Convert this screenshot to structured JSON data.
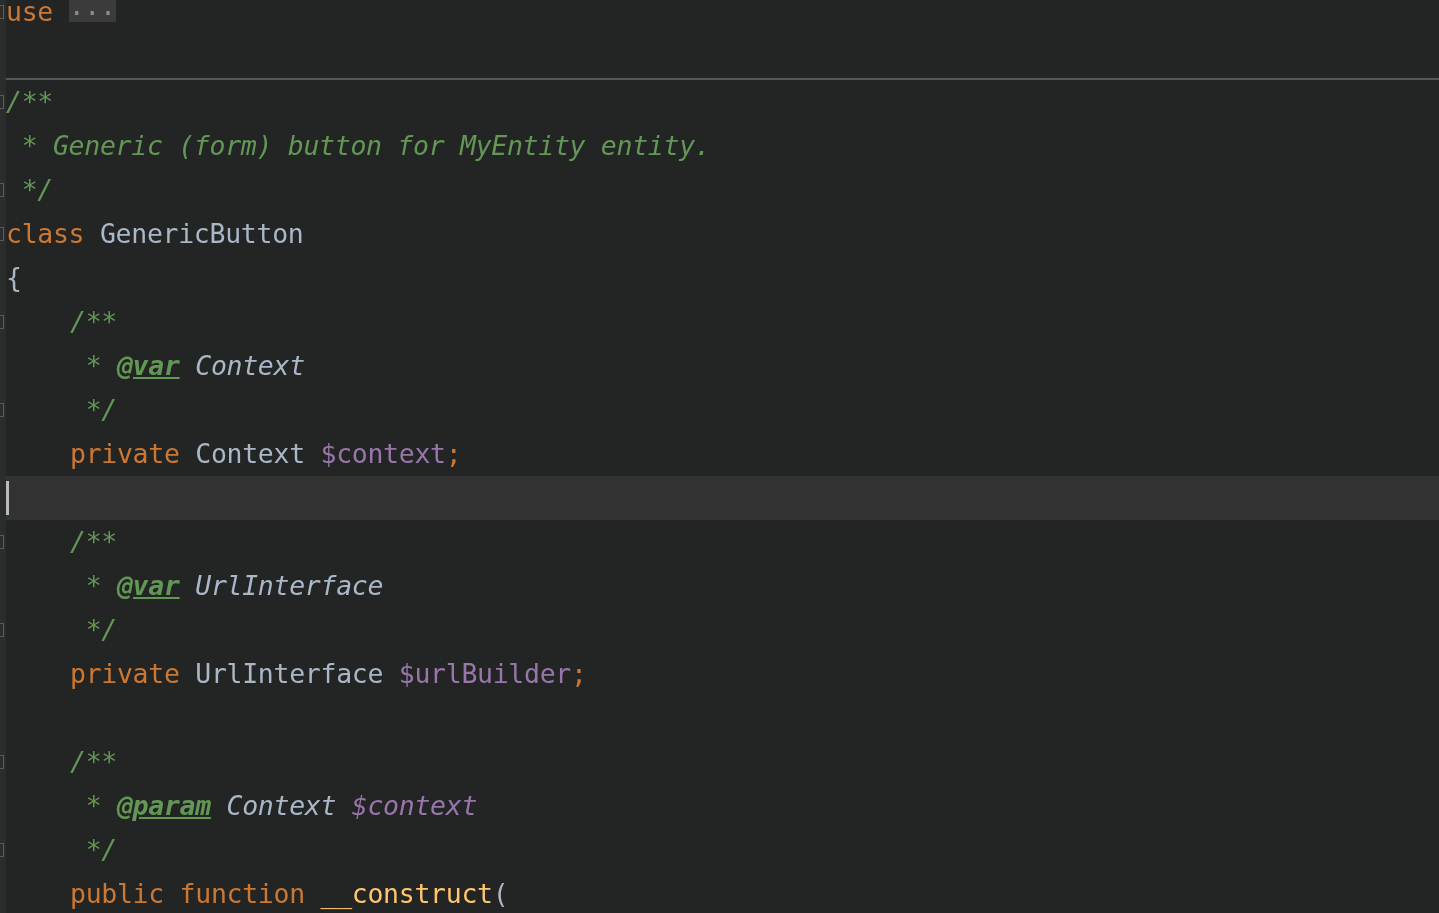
{
  "lines": [
    {
      "kind": "code",
      "fold": true,
      "tokens": [
        {
          "text": "use",
          "kind": "keyword"
        },
        {
          "text": "...",
          "kind": "folded"
        }
      ]
    },
    {
      "kind": "blank"
    },
    {
      "kind": "separator"
    },
    {
      "kind": "code",
      "fold": true,
      "tokens": [
        {
          "text": "/**",
          "kind": "comment"
        }
      ]
    },
    {
      "kind": "code",
      "tokens": [
        {
          "text": " * Generic (form) button for MyEntity entity.",
          "kind": "comment"
        }
      ]
    },
    {
      "kind": "code",
      "fold": true,
      "tokens": [
        {
          "text": " */",
          "kind": "comment"
        }
      ]
    },
    {
      "kind": "code",
      "fold": true,
      "tokens": [
        {
          "text": "class",
          "kind": "keyword"
        },
        {
          "text": "GenericButton",
          "kind": "plain"
        }
      ]
    },
    {
      "kind": "code",
      "tokens": [
        {
          "text": "{",
          "kind": "plain"
        }
      ],
      "children": [
        {
          "kind": "code",
          "fold": true,
          "tokens": [
            {
              "text": "/**",
              "kind": "comment"
            }
          ]
        },
        {
          "kind": "code",
          "tokens": [
            {
              "text": " *",
              "kind": "comment"
            },
            {
              "text": "@var",
              "kind": "doc-tag"
            },
            {
              "text": "Context",
              "kind": "doc-type"
            }
          ]
        },
        {
          "kind": "code",
          "fold": true,
          "tokens": [
            {
              "text": " */",
              "kind": "comment"
            }
          ]
        },
        {
          "kind": "code",
          "tokens": [
            {
              "text": "private",
              "kind": "keyword"
            },
            {
              "text": "Context",
              "kind": "plain"
            },
            {
              "text": "$context",
              "kind": "variable"
            },
            {
              "text": ";",
              "kind": "semicolon"
            }
          ]
        },
        {
          "kind": "blank",
          "current": true
        },
        {
          "kind": "code",
          "fold": true,
          "tokens": [
            {
              "text": "/**",
              "kind": "comment"
            }
          ]
        },
        {
          "kind": "code",
          "tokens": [
            {
              "text": " *",
              "kind": "comment"
            },
            {
              "text": "@var",
              "kind": "doc-tag"
            },
            {
              "text": "UrlInterface",
              "kind": "doc-type"
            }
          ]
        },
        {
          "kind": "code",
          "fold": true,
          "tokens": [
            {
              "text": " */",
              "kind": "comment"
            }
          ]
        },
        {
          "kind": "code",
          "tokens": [
            {
              "text": "private",
              "kind": "keyword"
            },
            {
              "text": "UrlInterface",
              "kind": "plain"
            },
            {
              "text": "$urlBuilder",
              "kind": "variable"
            },
            {
              "text": ";",
              "kind": "semicolon"
            }
          ]
        },
        {
          "kind": "blank"
        },
        {
          "kind": "code",
          "fold": true,
          "tokens": [
            {
              "text": "/**",
              "kind": "comment"
            }
          ]
        },
        {
          "kind": "code",
          "tokens": [
            {
              "text": " *",
              "kind": "comment"
            },
            {
              "text": "@param",
              "kind": "doc-tag"
            },
            {
              "text": "Context",
              "kind": "doc-type"
            },
            {
              "text": "$context",
              "kind": "doc-variable"
            }
          ]
        },
        {
          "kind": "code",
          "fold": true,
          "tokens": [
            {
              "text": " */",
              "kind": "comment"
            }
          ]
        },
        {
          "kind": "code",
          "tokens": [
            {
              "text": "public",
              "kind": "keyword"
            },
            {
              "text": "function",
              "kind": "keyword"
            },
            {
              "text": "__construct",
              "kind": "function"
            },
            {
              "text": "(",
              "kind": "paren"
            }
          ]
        }
      ]
    }
  ]
}
